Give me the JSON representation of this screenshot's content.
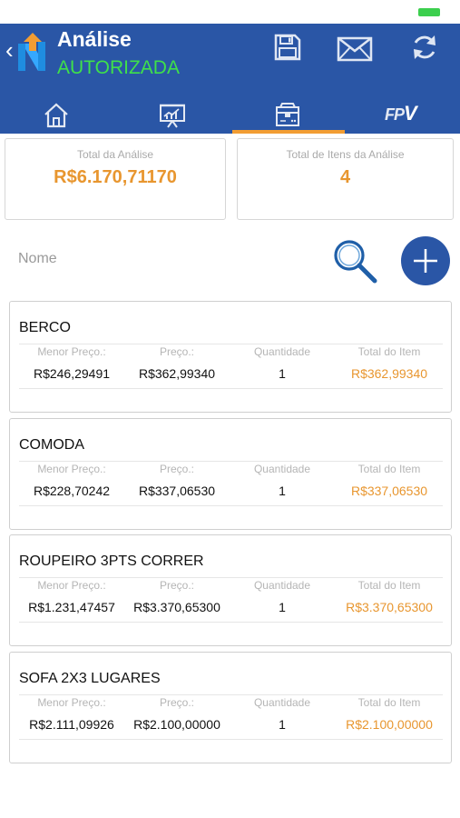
{
  "header": {
    "title": "Análise",
    "status": "AUTORIZADA",
    "colors": {
      "bar": "#2a56a6",
      "status": "#3fe04a",
      "accent": "#f29d33"
    },
    "actions": [
      "save-icon",
      "mail-icon",
      "refresh-icon"
    ]
  },
  "tabs": [
    {
      "icon": "home-icon",
      "active": false
    },
    {
      "icon": "chart-board-icon",
      "active": false
    },
    {
      "icon": "box-icon",
      "active": true
    },
    {
      "label_prefix": "FP",
      "label_suffix": "V",
      "active": false
    }
  ],
  "summary": {
    "total_label": "Total da Análise",
    "total_value": "R$6.170,71170",
    "items_label": "Total de Itens da Análise",
    "items_value": "4"
  },
  "search": {
    "placeholder": "Nome"
  },
  "columns": {
    "min_price": "Menor Preço.:",
    "price": "Preço.:",
    "quantity": "Quantidade",
    "total": "Total do Item"
  },
  "items": [
    {
      "name": "BERCO",
      "min_price": "R$246,29491",
      "price": "R$362,99340",
      "quantity": "1",
      "total": "R$362,99340"
    },
    {
      "name": "COMODA",
      "min_price": "R$228,70242",
      "price": "R$337,06530",
      "quantity": "1",
      "total": "R$337,06530"
    },
    {
      "name": "ROUPEIRO 3PTS CORRER",
      "min_price": "R$1.231,47457",
      "price": "R$3.370,65300",
      "quantity": "1",
      "total": "R$3.370,65300"
    },
    {
      "name": "SOFA 2X3 LUGARES",
      "min_price": "R$2.111,09926",
      "price": "R$2.100,00000",
      "quantity": "1",
      "total": "R$2.100,00000"
    }
  ]
}
